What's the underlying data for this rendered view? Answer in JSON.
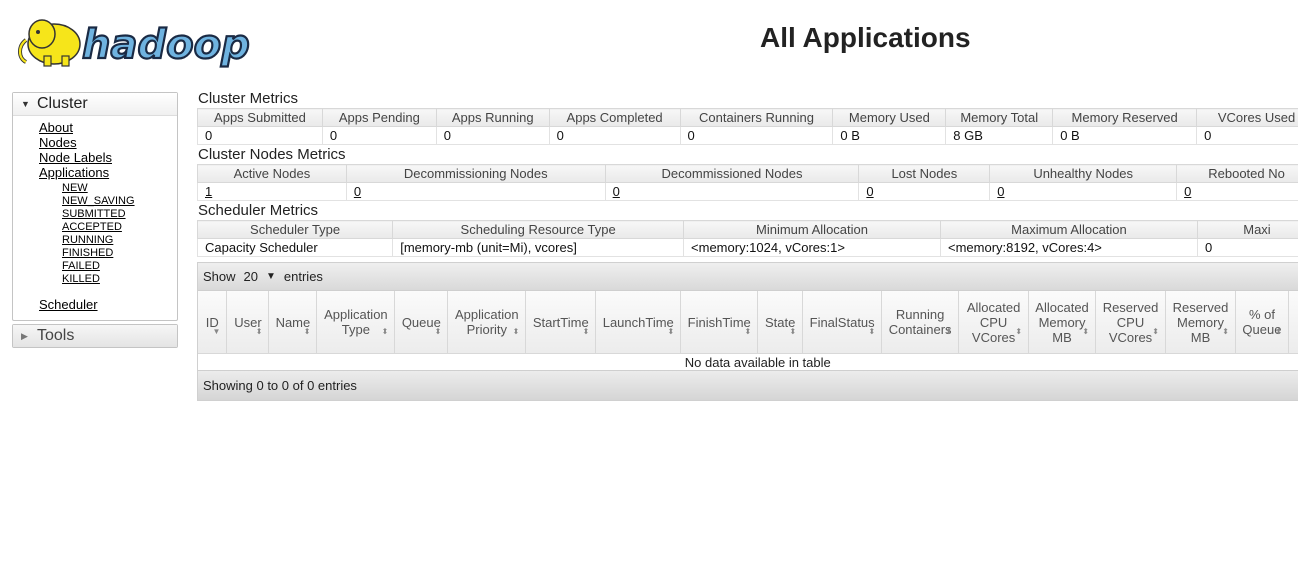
{
  "header": {
    "logo_text": "hadoop",
    "title": "All Applications"
  },
  "nav": {
    "cluster": {
      "label": "Cluster",
      "items": [
        "About",
        "Nodes",
        "Node Labels",
        "Applications"
      ],
      "app_states": [
        "NEW",
        "NEW_SAVING",
        "SUBMITTED",
        "ACCEPTED",
        "RUNNING",
        "FINISHED",
        "FAILED",
        "KILLED"
      ],
      "scheduler": "Scheduler"
    },
    "tools": {
      "label": "Tools"
    }
  },
  "cluster_metrics": {
    "title": "Cluster Metrics",
    "headers": [
      "Apps Submitted",
      "Apps Pending",
      "Apps Running",
      "Apps Completed",
      "Containers Running",
      "Memory Used",
      "Memory Total",
      "Memory Reserved",
      "VCores Used"
    ],
    "values": [
      "0",
      "0",
      "0",
      "0",
      "0",
      "0 B",
      "8 GB",
      "0 B",
      "0"
    ]
  },
  "nodes_metrics": {
    "title": "Cluster Nodes Metrics",
    "headers": [
      "Active Nodes",
      "Decommissioning Nodes",
      "Decommissioned Nodes",
      "Lost Nodes",
      "Unhealthy Nodes",
      "Rebooted No"
    ],
    "values": [
      "1",
      "0",
      "0",
      "0",
      "0",
      "0"
    ]
  },
  "scheduler_metrics": {
    "title": "Scheduler Metrics",
    "headers": [
      "Scheduler Type",
      "Scheduling Resource Type",
      "Minimum Allocation",
      "Maximum Allocation",
      "Maxi"
    ],
    "values": [
      "Capacity Scheduler",
      "[memory-mb (unit=Mi), vcores]",
      "<memory:1024, vCores:1>",
      "<memory:8192, vCores:4>",
      "0"
    ]
  },
  "apps_table": {
    "show_label": "Show",
    "page_size": "20",
    "entries_label": "entries",
    "columns": [
      "ID",
      "User",
      "Name",
      "Application Type",
      "Queue",
      "Application Priority",
      "StartTime",
      "LaunchTime",
      "FinishTime",
      "State",
      "FinalStatus",
      "Running Containers",
      "Allocated CPU VCores",
      "Allocated Memory MB",
      "Reserved CPU VCores",
      "Reserved Memory MB",
      "% of Queue"
    ],
    "empty_message": "No data available in table",
    "info": "Showing 0 to 0 of 0 entries"
  },
  "colors": {
    "logo_blue": "#6fb3e0",
    "logo_yellow": "#f6e51a"
  }
}
